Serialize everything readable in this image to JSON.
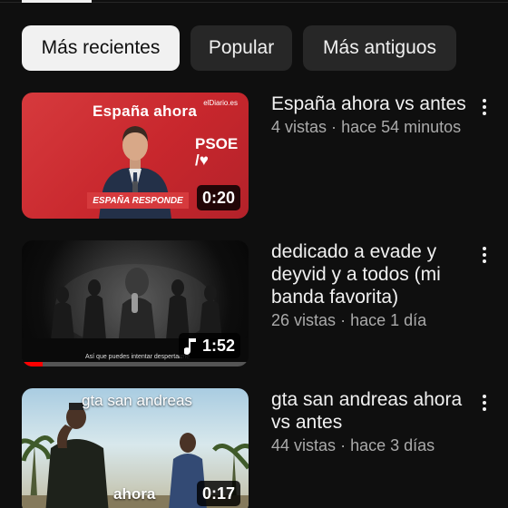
{
  "filters": {
    "chips": [
      "Más recientes",
      "Popular",
      "Más antiguos"
    ],
    "active_index": 0
  },
  "videos": [
    {
      "title": "España ahora vs antes",
      "views": "4 vistas",
      "age": "hace 54 minutos",
      "duration": "0:20",
      "thumbnail": {
        "overlay_title": "España ahora",
        "source": "elDiario.es",
        "party_line1": "PSOE",
        "party_line2": "/♥",
        "caption": "ESPAÑA RESPONDE"
      }
    },
    {
      "title": "dedicado a evade y deyvid y a todos (mi banda favorita)",
      "views": "26 vistas",
      "age": "hace 1 día",
      "duration": "1:52",
      "is_music": true,
      "watched_fraction": 0.09,
      "thumbnail": {
        "caption": "Así que puedes intentar despertarme"
      }
    },
    {
      "title": "gta san andreas ahora vs antes",
      "views": "44 vistas",
      "age": "hace 3 días",
      "duration": "0:17",
      "thumbnail": {
        "overlay_top": "gta san andreas",
        "overlay_bottom": "ahora"
      }
    }
  ],
  "meta_separator": "·",
  "colors": {
    "background": "#0f0f0f",
    "chip_bg": "#272727",
    "chip_active_bg": "#f1f1f1",
    "text_primary": "#f1f1f1",
    "text_secondary": "#aaaaaa",
    "progress": "#ff0000",
    "thumb1_red": "#c8272d"
  }
}
